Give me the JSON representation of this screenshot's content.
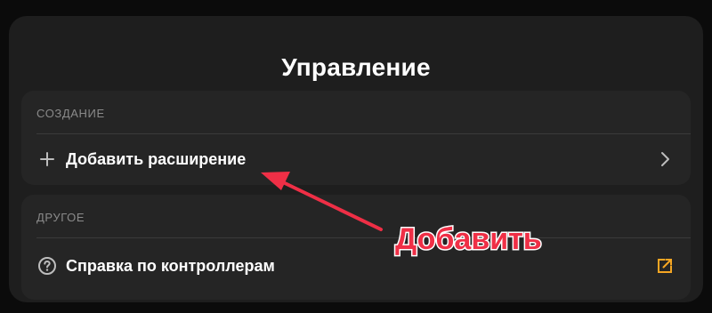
{
  "panel": {
    "title": "Управление"
  },
  "sections": {
    "create": {
      "header": "СОЗДАНИЕ",
      "row": {
        "icon": "plus-icon",
        "label": "Добавить расширение",
        "trailing_icon": "chevron-right-icon"
      }
    },
    "other": {
      "header": "ДРУГОЕ",
      "row": {
        "icon": "help-circle-icon",
        "label": "Справка по контроллерам",
        "trailing_icon": "external-link-icon"
      }
    }
  },
  "annotation": {
    "label": "Добавить",
    "color": "#ef2f46"
  },
  "colors": {
    "background": "#0b0b0b",
    "panel": "#1e1e1e",
    "section": "#252525",
    "muted_text": "#8a8a8a",
    "accent_orange": "#f5a623"
  }
}
